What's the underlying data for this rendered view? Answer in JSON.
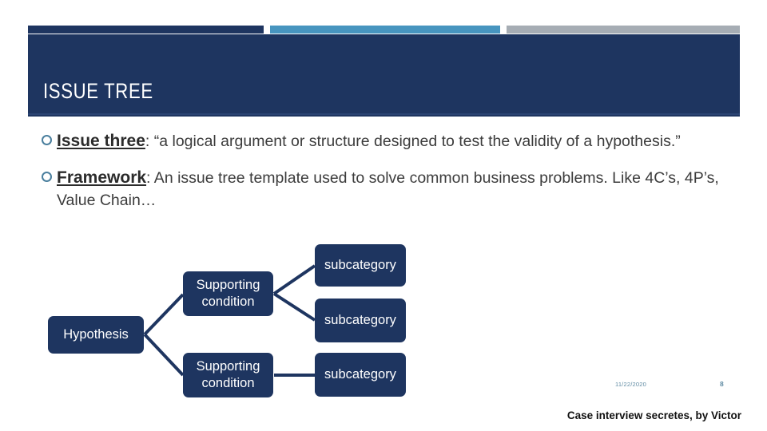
{
  "slide": {
    "title": "ISSUE TREE",
    "accent_navy": "#1e3560",
    "accent_blue": "#4795bf",
    "accent_gray": "#a6adb4",
    "bullet_marker_color": "#4a7f9e",
    "footer_text_color": "#5f8ba3"
  },
  "bullets": [
    {
      "marker": "hollow-circle-bullet",
      "lead": "Issue three",
      "text": ":  “a logical argument or structure designed to test the validity of a hypothesis.”"
    },
    {
      "marker": "hollow-circle-bullet",
      "lead": "Framework",
      "text": ":  An issue tree template used to solve common business problems. Like 4C’s, 4P’s, Value Chain…"
    }
  ],
  "diagram": {
    "type": "issue-tree",
    "nodes": {
      "hypothesis": "Hypothesis",
      "support_1": "Supporting condition",
      "support_2": "Supporting condition",
      "sub_1": "subcategory",
      "sub_2": "subcategory",
      "sub_3": "subcategory"
    },
    "edges": [
      {
        "from": "hypothesis",
        "to": "support_1"
      },
      {
        "from": "hypothesis",
        "to": "support_2"
      },
      {
        "from": "support_1",
        "to": "sub_1"
      },
      {
        "from": "support_1",
        "to": "sub_2"
      },
      {
        "from": "support_2",
        "to": "sub_3"
      }
    ]
  },
  "footer": {
    "date": "11/22/2020",
    "slide_number": "8",
    "credit": "Case interview secretes, by Victor"
  }
}
